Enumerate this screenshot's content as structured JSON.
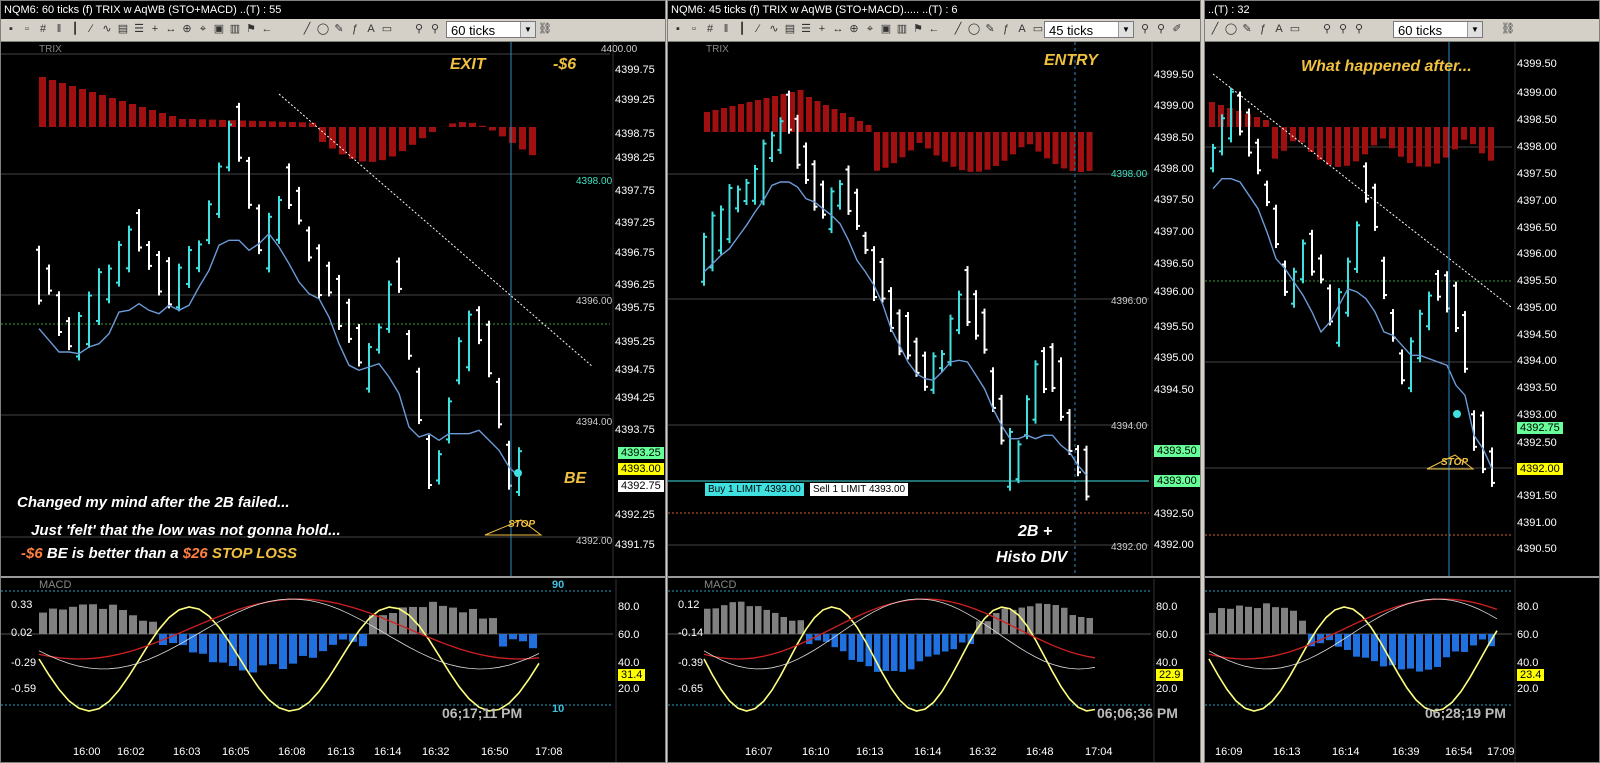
{
  "panels": [
    {
      "title": "NQM6: 60 ticks (f)    TRIX w AqWB (STO+MACD)      ..(T) : 55",
      "tick_setting": "60 ticks",
      "trix_label": "TRIX",
      "top_label": "4400.00",
      "price_axis": [
        "4399.75",
        "4399.25",
        "4398.75",
        "4398.25",
        "4397.75",
        "4397.25",
        "4396.75",
        "4396.25",
        "4395.75",
        "4395.25",
        "4394.75",
        "4394.25",
        "4393.75",
        "4392.25",
        "4391.75"
      ],
      "level_labels": [
        "4398.00",
        "4396.00",
        "4394.00",
        "4392.00"
      ],
      "price_flags": [
        {
          "text": "4393.25",
          "bg": "#66ff99"
        },
        {
          "text": "4393.00",
          "bg": "#ffff00"
        },
        {
          "text": "4392.75",
          "bg": "#ffffff"
        }
      ],
      "annotations": {
        "exit": "EXIT",
        "pnl": "-$6",
        "be": "BE",
        "stop": "STOP",
        "note_line1": "Changed my mind after the 2B failed...",
        "note_line2": "Just 'felt' that the low was not gonna hold...",
        "note_line3_a": "-$6",
        "note_line3_b": " BE  is better than a ",
        "note_line3_c": "$26",
        "note_line3_d": " STOP LOSS"
      },
      "macd": {
        "label": "MACD",
        "level_top": "90",
        "level_bottom": "10",
        "left_axis": [
          "0.33",
          "0.02",
          "-0.29",
          "-0.59"
        ],
        "right_axis": [
          "80.0",
          "60.0",
          "40.0",
          "20.0"
        ],
        "value_flag": "31.4",
        "time_axis": [
          "16:00",
          "16:02",
          "16:03",
          "16:05",
          "16:08",
          "16:13",
          "16:14",
          "16:32",
          "16:50",
          "17:08"
        ],
        "clock": "06;17;11 PM"
      }
    },
    {
      "title": "NQM6: 45 ticks (f)    TRIX w AqWB (STO+MACD)..... ..(T) : 6",
      "tick_setting": "45 ticks",
      "trix_label": "TRIX",
      "price_axis": [
        "4399.50",
        "4399.00",
        "4398.50",
        "4398.00",
        "4397.50",
        "4397.00",
        "4396.50",
        "4396.00",
        "4395.50",
        "4395.00",
        "4394.50",
        "4394.00",
        "4392.50",
        "4392.00"
      ],
      "level_labels": [
        "4398.00",
        "4396.00",
        "4394.00",
        "4392.00"
      ],
      "price_flags": [
        {
          "text": "4393.50",
          "bg": "#66ff99"
        },
        {
          "text": "4393.00",
          "bg": "#66ff99"
        }
      ],
      "orders": {
        "buy": "Buy 1 LIMIT 4393.00",
        "sell": "Sell 1 LIMIT 4393.00"
      },
      "annotations": {
        "entry": "ENTRY",
        "setup_line1": "2B +",
        "setup_line2": "Histo DIV"
      },
      "macd": {
        "label": "MACD",
        "left_axis": [
          "0.12",
          "-0.14",
          "-0.39",
          "-0.65"
        ],
        "right_axis": [
          "80.0",
          "60.0",
          "40.0",
          "20.0"
        ],
        "value_flag": "22.9",
        "time_axis": [
          "16:07",
          "16:10",
          "16:13",
          "16:14",
          "16:32",
          "16:48",
          "17:04"
        ],
        "clock": "06;06;36 PM"
      }
    },
    {
      "title": "..(T) : 32",
      "tick_setting": "60 ticks",
      "price_axis": [
        "4399.50",
        "4399.00",
        "4398.50",
        "4398.00",
        "4397.50",
        "4397.00",
        "4396.50",
        "4396.00",
        "4395.50",
        "4395.00",
        "4394.50",
        "4394.00",
        "4393.50",
        "4393.00",
        "4392.50",
        "4391.50",
        "4391.00",
        "4390.50"
      ],
      "price_flags": [
        {
          "text": "4392.75",
          "bg": "#66ff99"
        },
        {
          "text": "4392.00",
          "bg": "#ffff00"
        }
      ],
      "annotations": {
        "after": "What happened after...",
        "stop": "STOP"
      },
      "macd": {
        "right_axis": [
          "80.0",
          "60.0",
          "40.0",
          "20.0"
        ],
        "value_flag": "23.4",
        "time_axis": [
          "16:09",
          "16:13",
          "16:14",
          "16:39",
          "16:54",
          "17:09"
        ],
        "clock": "06;28;19 PM"
      }
    }
  ],
  "colors": {
    "up_bar": "#40e0e0",
    "down_bar": "#ffffff",
    "trix_hist": "#a01010",
    "macd_pos": "#808080",
    "macd_neg": "#2070e0",
    "ma_line": "#6b9bd8",
    "stoch": "#ffff80",
    "signal": "#d02020",
    "annotation": "#f0c040",
    "cursor": "#2e8bc0"
  }
}
